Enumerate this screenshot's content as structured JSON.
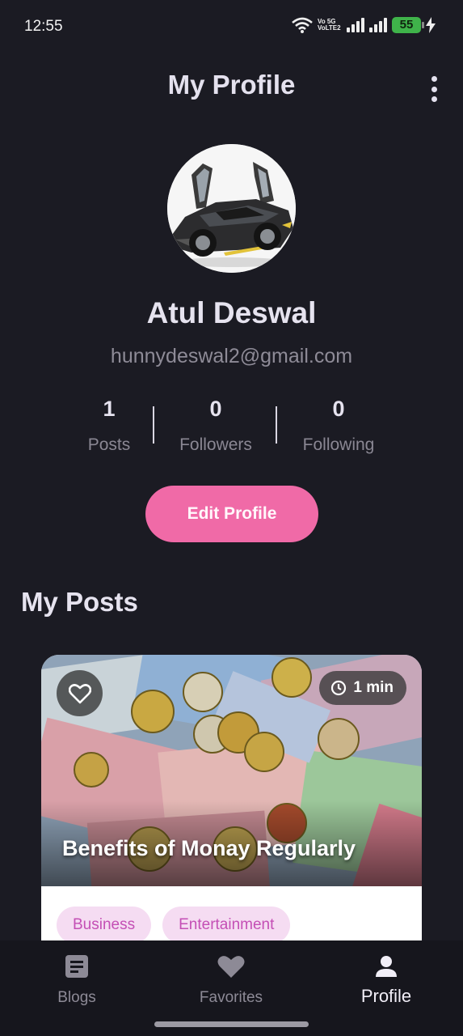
{
  "status_bar": {
    "time": "12:55",
    "network_label": "Vo 5G VoLTE2",
    "battery": "55"
  },
  "header": {
    "title": "My Profile"
  },
  "profile": {
    "name": "Atul Deswal",
    "email": "hunnydeswal2@gmail.com"
  },
  "stats": [
    {
      "value": "1",
      "label": "Posts"
    },
    {
      "value": "0",
      "label": "Followers"
    },
    {
      "value": "0",
      "label": "Following"
    }
  ],
  "edit_profile_label": "Edit Profile",
  "posts_section": {
    "title": "My Posts",
    "posts": [
      {
        "title": "Benefits of Monay Regularly",
        "read_time": "1 min",
        "tags": [
          "Business",
          "Entertainment"
        ]
      }
    ]
  },
  "bottom_nav": {
    "items": [
      {
        "label": "Blogs",
        "icon": "article-icon",
        "active": false
      },
      {
        "label": "Favorites",
        "icon": "heart-icon",
        "active": false
      },
      {
        "label": "Profile",
        "icon": "person-icon",
        "active": true
      }
    ]
  },
  "colors": {
    "background": "#1b1b23",
    "accent": "#f06aa7",
    "tag_background": "#f5dcf2",
    "tag_text": "#c44fb5"
  }
}
